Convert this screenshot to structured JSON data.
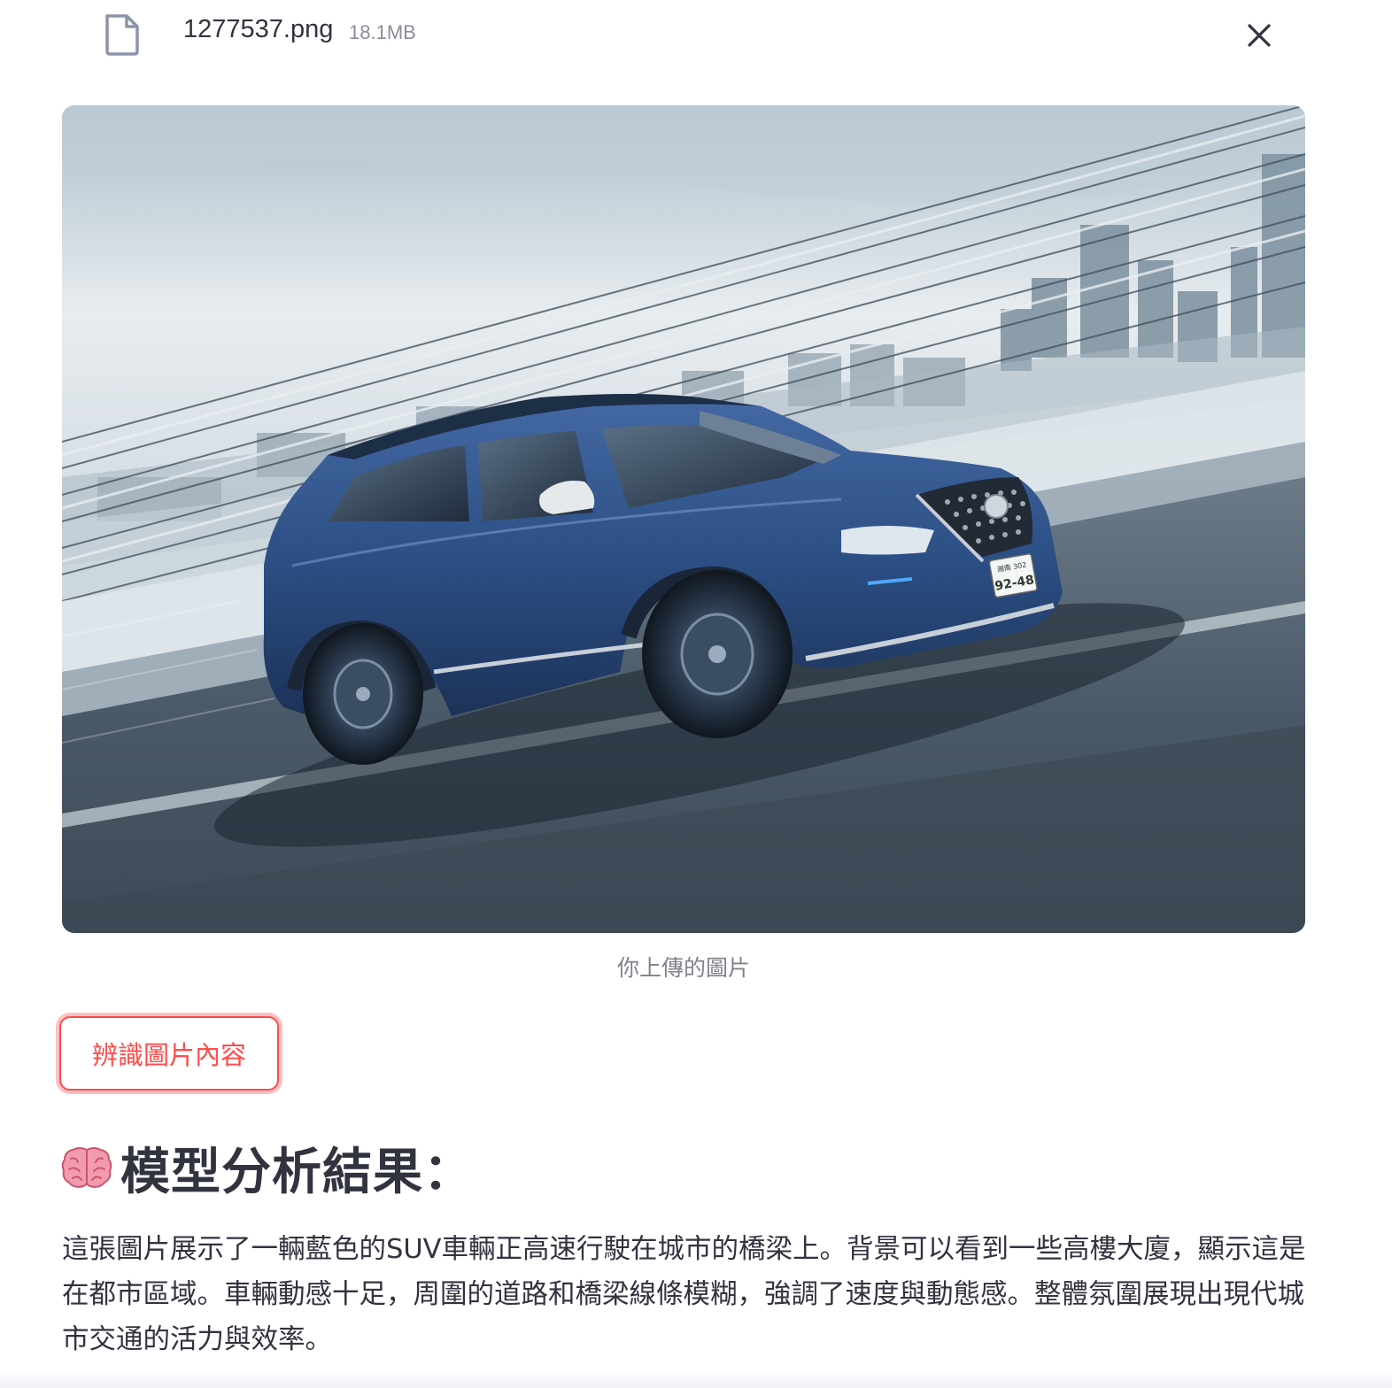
{
  "file": {
    "name": "1277537.png",
    "size": "18.1MB",
    "icon": "file-icon",
    "close_icon": "close-icon"
  },
  "image": {
    "caption": "你上傳的圖片",
    "license_plate_top": "湘南 302",
    "license_plate_bottom": "せ92-48"
  },
  "button": {
    "label": "辨識圖片內容"
  },
  "result": {
    "icon": "brain-icon",
    "heading": "模型分析結果：",
    "text": "這張圖片展示了一輛藍色的SUV車輛正高速行駛在城市的橋梁上。背景可以看到一些高樓大廈，顯示這是在都市區域。車輛動感十足，周圍的道路和橋梁線條模糊，強調了速度與動態感。整體氛圍展現出現代城市交通的活力與效率。"
  },
  "colors": {
    "accent": "#ff4b4b",
    "text": "#31333f",
    "muted": "#7f828b",
    "car_blue": "#2c4f85"
  }
}
